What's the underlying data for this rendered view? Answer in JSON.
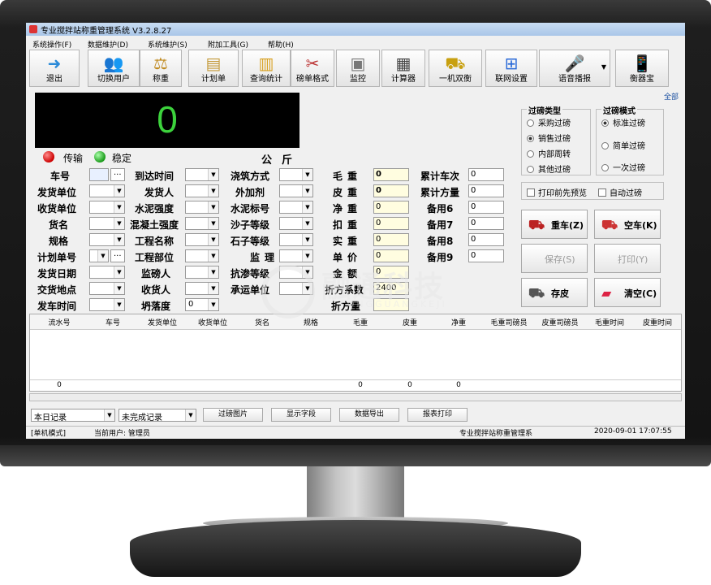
{
  "window": {
    "title": "专业搅拌站称重管理系统 V3.2.8.27"
  },
  "menu": [
    "系统操作(F)",
    "数据维护(D)",
    "系统维护(S)",
    "附加工具(G)",
    "帮助(H)"
  ],
  "toolbar": [
    {
      "label": "退出",
      "icon": "exit-icon"
    },
    {
      "label": "切换用户",
      "icon": "user-switch-icon"
    },
    {
      "label": "称重",
      "icon": "scale-icon"
    },
    {
      "label": "计划单",
      "icon": "plan-icon"
    },
    {
      "label": "查询统计",
      "icon": "chart-icon"
    },
    {
      "label": "磅单格式",
      "icon": "tools-icon"
    },
    {
      "label": "监控",
      "icon": "camera-icon"
    },
    {
      "label": "计算器",
      "icon": "calculator-icon"
    },
    {
      "label": "一机双衡",
      "icon": "truck-icon"
    },
    {
      "label": "联网设置",
      "icon": "network-icon"
    },
    {
      "label": "语音播报",
      "icon": "microphone-icon"
    },
    {
      "label": "衡器宝",
      "icon": "phone-icon"
    }
  ],
  "all_link": "全部",
  "display": {
    "weight": "0",
    "unit": "公斤"
  },
  "status": {
    "transmit": "传输",
    "stable": "稳定"
  },
  "fields": {
    "col1": [
      "车号",
      "发货单位",
      "收货单位",
      "货名",
      "规格",
      "计划单号",
      "发货日期",
      "交货地点",
      "发车时间"
    ],
    "col2": [
      "到达时间",
      "发货人",
      "水泥强度",
      "混凝土强度",
      "工程名称",
      "工程部位",
      "监磅人",
      "收货人",
      "坍落度"
    ],
    "col3": [
      "浇筑方式",
      "外加剂",
      "水泥标号",
      "沙子等级",
      "石子等级",
      "监理",
      "抗渗等级",
      "承运单位"
    ],
    "col4": [
      "毛重",
      "皮重",
      "净重",
      "扣重",
      "实重",
      "单价",
      "金额",
      "折方系数",
      "折方量"
    ],
    "col4_values": [
      "0",
      "0",
      "0",
      "0",
      "0",
      "0",
      "0",
      "2400",
      ""
    ],
    "col5": [
      "累计车次",
      "累计方量",
      "备用6",
      "备用7",
      "备用8",
      "备用9"
    ],
    "col5_values": [
      "0",
      "0",
      "0",
      "0",
      "0",
      "0"
    ],
    "slump_value": "0"
  },
  "weigh_type": {
    "title": "过磅类型",
    "options": [
      "采购过磅",
      "销售过磅",
      "内部周转",
      "其他过磅"
    ],
    "selected": 1
  },
  "weigh_mode": {
    "title": "过磅模式",
    "options": [
      "标准过磅",
      "简单过磅",
      "一次过磅"
    ],
    "selected": 0
  },
  "checks": {
    "preview": "打印前先预览",
    "auto": "自动过磅"
  },
  "actions": {
    "heavy": "重车(Z)",
    "empty": "空车(K)",
    "save": "保存(S)",
    "print": "打印(Y)",
    "tare": "存皮",
    "clear": "清空(C)"
  },
  "grid": {
    "columns": [
      "流水号",
      "车号",
      "发货单位",
      "收货单位",
      "货名",
      "规格",
      "毛重",
      "皮重",
      "净重",
      "毛重司磅员",
      "皮重司磅员",
      "毛重时间",
      "皮重时间"
    ],
    "totals": [
      "0",
      "",
      "",
      "",
      "",
      "",
      "0",
      "0",
      "0",
      "",
      "",
      "",
      ""
    ]
  },
  "bottom": {
    "filter1": "本日记录",
    "filter2": "未完成记录",
    "buttons": [
      "过磅图片",
      "显示字段",
      "数据导出",
      "报表打印"
    ]
  },
  "statusbar": {
    "mode": "[单机模式]",
    "user": "当前用户: 管理员",
    "app": "专业搅拌站称重管理系",
    "time": "2020-09-01 17:07:55"
  },
  "watermark": {
    "text": "融通科技",
    "sub": "TONGGUANGKEJI"
  }
}
